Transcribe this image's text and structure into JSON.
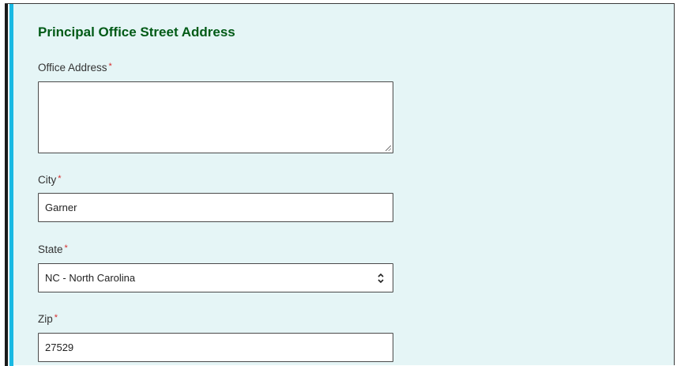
{
  "section": {
    "title": "Principal Office Street Address"
  },
  "required_marker": "*",
  "fields": {
    "office_address": {
      "label": "Office Address",
      "value": ""
    },
    "city": {
      "label": "City",
      "value": "Garner"
    },
    "state": {
      "label": "State",
      "value": "NC - North Carolina"
    },
    "zip": {
      "label": "Zip",
      "value": "27529"
    }
  },
  "colors": {
    "panel_background": "#e5f5f6",
    "accent_bar": "#1ab9e3",
    "heading": "#005a16",
    "required": "#d62b2b"
  },
  "icons": {
    "select_arrows": "chevron-up-down-icon",
    "resize_grip": "resize-grip-icon"
  }
}
